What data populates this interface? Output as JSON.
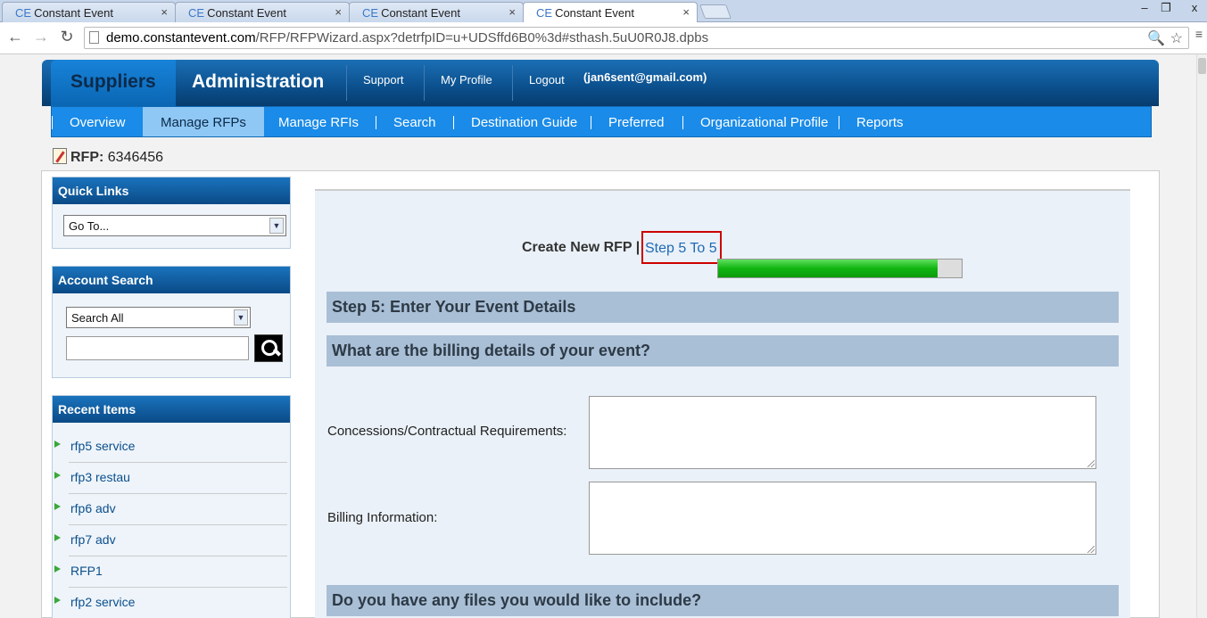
{
  "browser": {
    "tabs": [
      {
        "logo": "CE",
        "title": "Constant Event"
      },
      {
        "logo": "CE",
        "title": "Constant Event"
      },
      {
        "logo": "CE",
        "title": "Constant Event"
      },
      {
        "logo": "CE",
        "title": "Constant Event"
      }
    ],
    "tab_close": "×",
    "url_domain": "demo.constantevent.com",
    "url_path": "/RFP/RFPWizard.aspx?detrfpID=u+UDSffd6B0%3d#sthash.5uU0R0J8.dpbs",
    "back_icon": "back-arrow-icon",
    "forward_icon": "forward-arrow-icon",
    "reload_icon": "reload-icon",
    "window_controls": {
      "minimize": "–",
      "restore": "❐",
      "close": "x"
    }
  },
  "header": {
    "suppliers": "Suppliers",
    "administration": "Administration",
    "links": [
      "Support",
      "My Profile",
      "Logout"
    ],
    "email": "(jan6sent@gmail.com)"
  },
  "subnav": {
    "items": [
      "Overview",
      "Manage RFPs",
      "Manage RFIs",
      "Search",
      "Destination Guide",
      "Preferred",
      "Organizational Profile",
      "Reports"
    ],
    "active": "Manage RFPs"
  },
  "rfp": {
    "label": "RFP:",
    "number": "6346456"
  },
  "quick_links": {
    "title": "Quick Links",
    "select_value": "Go To..."
  },
  "account_search": {
    "title": "Account Search",
    "select_value": "Search All",
    "input_value": ""
  },
  "recent_items": {
    "title": "Recent Items",
    "items": [
      "rfp5 service",
      "rfp3 restau",
      "rfp6 adv",
      "rfp7 adv",
      "RFP1",
      "rfp2 service"
    ]
  },
  "wizard": {
    "title": "Create New RFP |",
    "step_link": "Step 5 To 5",
    "progress": 0.9,
    "step_header": "Step 5: Enter Your Event Details",
    "billing_header": "What are the billing details of your event?",
    "concessions_label": "Concessions/Contractual Requirements:",
    "concessions_value": "",
    "billing_label": "Billing Information:",
    "billing_value": "",
    "files_header": "Do you have any files you would like to include?"
  },
  "colors": {
    "nav_dark": "#0b4f8c",
    "subnav_blue": "#1a8be8",
    "section_bar": "#a9bfd6",
    "progress_green": "#11b511",
    "highlight_red": "#cc0000"
  }
}
